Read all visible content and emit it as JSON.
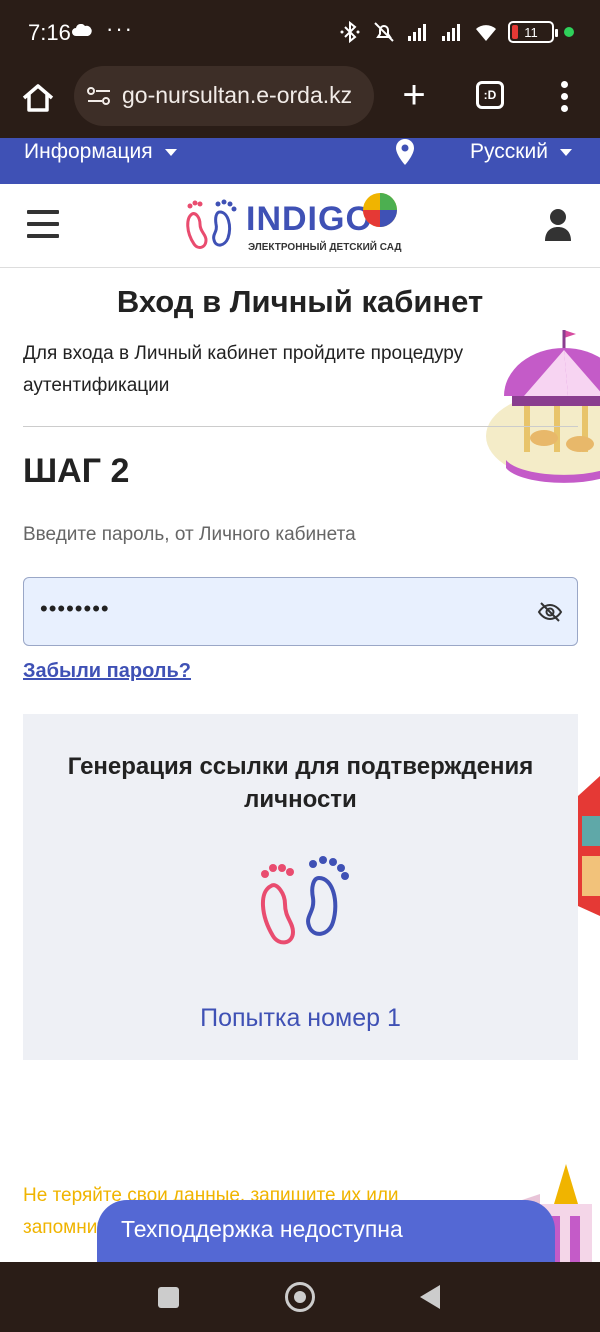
{
  "status_bar": {
    "time": "7:16",
    "dots": "···",
    "battery_level": "11",
    "icons": [
      "cloud-icon",
      "bluetooth-icon",
      "mute-icon",
      "signal-icon",
      "signal-icon",
      "wifi-icon",
      "battery-icon"
    ]
  },
  "browser": {
    "url": "go-nursultan.e-orda.kz",
    "tabs_label": ":D"
  },
  "top_nav": {
    "info_label": "Информация",
    "language_label": "Русский"
  },
  "header": {
    "logo_text": "INDIGO",
    "logo_subtitle": "ЭЛЕКТРОННЫЙ ДЕТСКИЙ САД"
  },
  "main": {
    "title": "Вход в Личный кабинет",
    "description": "Для входа в Личный кабинет пройдите процедуру аутентификации",
    "step": "ШАГ 2",
    "password_hint": "Введите пароль, от Личного кабинета",
    "password_value": "••••••••",
    "forgot_link": "Забыли пароль?"
  },
  "generation": {
    "title": "Генерация ссылки для подтверждения личности",
    "attempt": "Попытка номер 1"
  },
  "warning": {
    "text": "Не теряйте свои данные, запишите их или запомните логин и пароль"
  },
  "support": {
    "label": "Техподдержка недоступна"
  },
  "colors": {
    "brand_blue": "#3f51b5",
    "warning_yellow": "#f0b400",
    "field_bg": "#e8f0fe",
    "support_bg": "#5468d4"
  }
}
